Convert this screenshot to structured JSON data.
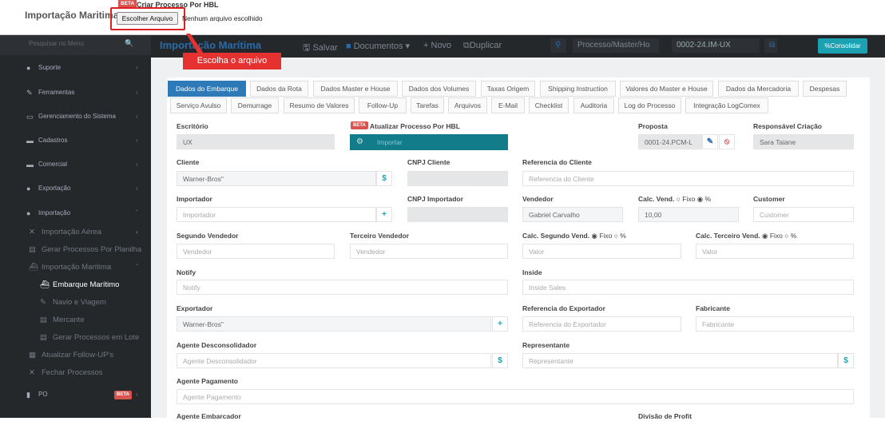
{
  "overlay": {
    "title": "Importação Maritima",
    "beta": "BETA",
    "heading": "Criar Processo Por HBL",
    "file_button": "Escolher Arquivo",
    "no_file": "Nenhum arquivo escolhido",
    "callout": "Escolha o arquivo"
  },
  "sidebar": {
    "search_placeholder": "Pesquisar no Menu",
    "items": [
      {
        "label": "Suporte",
        "icon": "globe-icon"
      },
      {
        "label": "Ferramentas",
        "icon": "wrench-icon"
      },
      {
        "label": "Gerenciamento do Sistema",
        "icon": "laptop-icon"
      },
      {
        "label": "Cadastros",
        "icon": "box-icon"
      },
      {
        "label": "Comercial",
        "icon": "briefcase-icon"
      },
      {
        "label": "Exportação",
        "icon": "circle-arrow-icon"
      },
      {
        "label": "Importação",
        "icon": "circle-arrow-icon"
      }
    ],
    "subitems": [
      {
        "label": "Importação Aérea"
      },
      {
        "label": "Gerar Processos Por Planilha"
      },
      {
        "label": "Importação Marítima"
      },
      {
        "label": "Embarque Marítimo"
      },
      {
        "label": "Navio e Viagem"
      },
      {
        "label": "Mercante"
      },
      {
        "label": "Gerar Processos em Lote"
      },
      {
        "label": "Atualizar Follow-UP's"
      },
      {
        "label": "Fechar Processos"
      }
    ],
    "po_label": "PO",
    "po_badge": "BETA"
  },
  "toolbar": {
    "title": "Importação Marítima",
    "save": "Salvar",
    "documents": "Documentos",
    "new": "Novo",
    "duplicate": "Duplicar",
    "search_placeholder": "Processo/Master/Ho",
    "process_number": "0002-24.IM-UX",
    "consolidate": "Consolidar"
  },
  "tabs_row1": [
    "Dados do Embarque",
    "Dados da Rota",
    "Dados Master e House",
    "Dados dos Volumes",
    "Taxas Origem",
    "Shipping Instruction",
    "Valores do Master e House",
    "Dados da Mercadoria",
    "Despesas"
  ],
  "tabs_row2": [
    "Serviço Avulso",
    "Demurrage",
    "Resumo de Valores",
    "Follow-Up",
    "Tarefas",
    "Arquivos",
    "E-Mail",
    "Checklist",
    "Auditoria",
    "Log do Processo",
    "Integração LogComex"
  ],
  "form": {
    "escritorio_label": "Escritório",
    "escritorio_value": "UX",
    "atualizar_beta": "BETA",
    "atualizar_label": "Atualizar Processo Por HBL",
    "importar": "Importar",
    "proposta_label": "Proposta",
    "proposta_value": "0001-24.PCM-L",
    "resp_label": "Responsável Criação",
    "resp_value": "Sara Taiane",
    "cliente_label": "Cliente",
    "cliente_value": "Warner-Bros\"",
    "cnpj_cliente_label": "CNPJ Cliente",
    "ref_cliente_label": "Referencia do Cliente",
    "ref_cliente_ph": "Referencia do Cliente",
    "importador_label": "Importador",
    "importador_ph": "Importador",
    "cnpj_importador_label": "CNPJ Importador",
    "vendedor_label": "Vendedor",
    "vendedor_value": "Gabriel Carvalho",
    "calc_vend_label": "Calc. Vend.",
    "fixo": "Fixo",
    "pct": "%",
    "calc_vend_value": "10,00",
    "customer_label": "Customer",
    "customer_ph": "Customer",
    "seg_vend_label": "Segundo Vendedor",
    "seg_vend_ph": "Vendedor",
    "ter_vend_label": "Terceiro Vendedor",
    "ter_vend_ph": "Vendedor",
    "calc_seg_label": "Calc. Segundo Vend.",
    "calc_seg_ph": "Valor",
    "calc_ter_label": "Calc. Terceiro Vend.",
    "calc_ter_ph": "Valor",
    "notify_label": "Notify",
    "notify_ph": "Notify",
    "inside_label": "Inside",
    "inside_ph": "Inside Sales",
    "exportador_label": "Exportador",
    "exportador_value": "Warner-Bros\"",
    "ref_exp_label": "Referencia do Exportador",
    "ref_exp_ph": "Referencia do Exportador",
    "fabricante_label": "Fabricante",
    "fabricante_ph": "Fabricante",
    "agente_descon_label": "Agente Desconsolidador",
    "agente_descon_ph": "Agente Desconsolidador",
    "representante_label": "Representante",
    "representante_ph": "Representante",
    "agente_pag_label": "Agente Pagamento",
    "agente_pag_ph": "Agente Pagamento",
    "agente_emb_label": "Agente Embarcador",
    "divisao_label": "Divisão de Profit"
  }
}
